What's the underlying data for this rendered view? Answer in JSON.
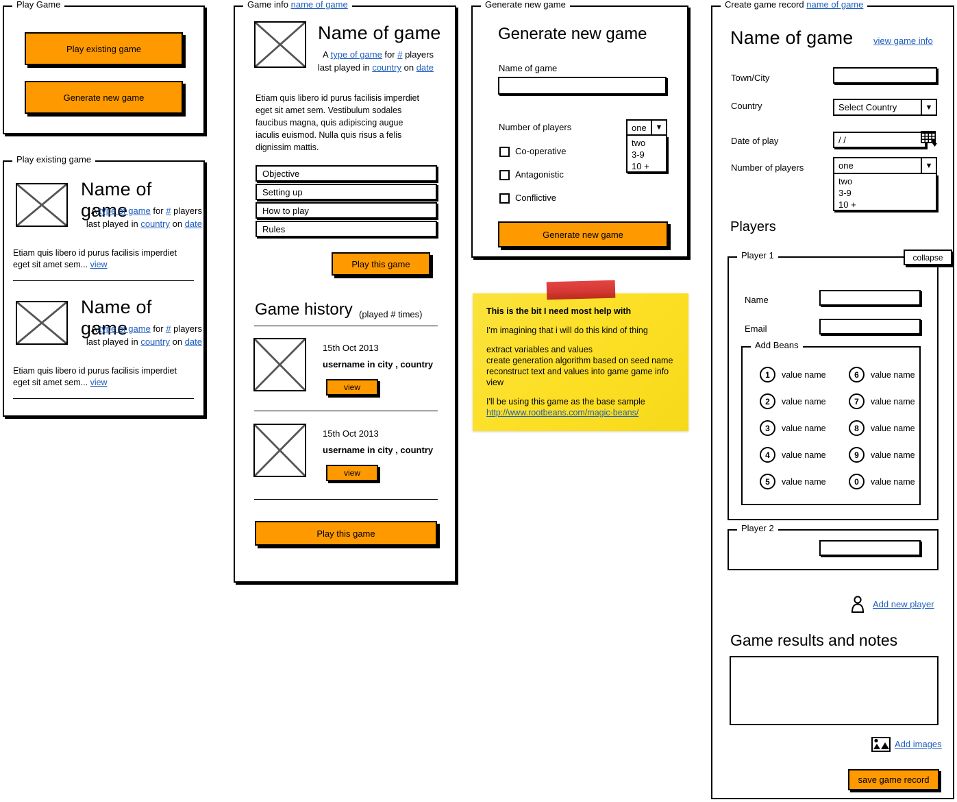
{
  "panels": {
    "play_game": {
      "legend": "Play Game"
    },
    "play_existing": {
      "legend": "Play existing game"
    },
    "game_info": {
      "legend_prefix": "Game info",
      "legend_link": "name of game"
    },
    "generate": {
      "legend": "Generate new game"
    },
    "create_record": {
      "legend_prefix": "Create game record",
      "legend_link": "name of game"
    }
  },
  "play_game": {
    "buttons": [
      {
        "label": "Play existing game"
      },
      {
        "label": "Generate new game"
      }
    ]
  },
  "play_existing": {
    "games": [
      {
        "title": "Name of game",
        "meta_a": "A",
        "type_link": "type of game",
        "meta_for": "for",
        "players_link": "#",
        "meta_players": "players",
        "meta_last": "last played in",
        "country_link": "country",
        "meta_on": "on",
        "date_link": "date",
        "excerpt": "Etiam quis libero id purus facilisis imperdiet eget sit amet sem...",
        "view_link": "view"
      },
      {
        "title": "Name of game",
        "meta_a": "A",
        "type_link": "type of game",
        "meta_for": "for",
        "players_link": "#",
        "meta_players": "players",
        "meta_last": "last played in",
        "country_link": "country",
        "meta_on": "on",
        "date_link": "date",
        "excerpt": "Etiam quis libero id purus facilisis imperdiet eget sit amet sem...",
        "view_link": "view"
      }
    ]
  },
  "game_info": {
    "title": "Name of game",
    "meta_a": "A",
    "type_link": "type of game",
    "meta_for": "for",
    "players_link": "#",
    "meta_players": "players",
    "meta_last": "last played in",
    "country_link": "country",
    "meta_on": "on",
    "date_link": "date",
    "description": "Etiam quis libero id purus facilisis imperdiet eget sit amet sem. Vestibulum sodales faucibus magna, quis adipiscing augue iaculis euismod. Nulla quis risus a felis dignissim mattis.",
    "sections": [
      "Objective",
      "Setting up",
      "How to play",
      "Rules"
    ],
    "play_button": "Play this game",
    "history_title": "Game history",
    "history_count": "(played # times)",
    "history": [
      {
        "date": "15th Oct 2013",
        "who": "username in city , country",
        "view": "view"
      },
      {
        "date": "15th Oct 2013",
        "who": "username in city , country",
        "view": "view"
      }
    ],
    "play_button_bottom": "Play this game"
  },
  "generate": {
    "heading": "Generate new game",
    "name_label": "Name of game",
    "name_value": "",
    "players_label": "Number of players",
    "players_selected": "one",
    "players_options": [
      "two",
      "3-9",
      "10 +"
    ],
    "checkboxes": [
      {
        "label": "Co-operative",
        "checked": false
      },
      {
        "label": "Antagonistic",
        "checked": false
      },
      {
        "label": "Conflictive",
        "checked": false
      }
    ],
    "submit": "Generate new game"
  },
  "note": {
    "title": "This is the bit I need most help with",
    "line1": "I'm imagining that i will do this kind of thing",
    "lines": [
      "extract variables and values",
      "create generation algorithm based on seed name",
      "reconstruct text and values into game game info",
      "view"
    ],
    "closing": "I'll be using this game as the base sample",
    "url": "http://www.rootbeans.com/magic-beans/"
  },
  "create_record": {
    "title": "Name of game",
    "view_info_link": "view game info",
    "fields": {
      "town_label": "Town/City",
      "town_value": "",
      "country_label": "Country",
      "country_selected": "Select Country",
      "date_label": "Date of play",
      "date_value": "/ /",
      "players_label": "Number of players",
      "players_selected": "one",
      "players_options": [
        "two",
        "3-9",
        "10 +"
      ]
    },
    "players_heading": "Players",
    "player1": {
      "legend": "Player 1",
      "collapse": "collapse",
      "name_label": "Name",
      "name_value": "",
      "email_label": "Email",
      "email_value": "",
      "beans_legend": "Add Beans",
      "beans_left": [
        {
          "num": "1",
          "label": "value name"
        },
        {
          "num": "2",
          "label": "value name"
        },
        {
          "num": "3",
          "label": "value name"
        },
        {
          "num": "4",
          "label": "value name"
        },
        {
          "num": "5",
          "label": "value name"
        }
      ],
      "beans_right": [
        {
          "num": "6",
          "label": "value name"
        },
        {
          "num": "7",
          "label": "value name"
        },
        {
          "num": "8",
          "label": "value name"
        },
        {
          "num": "9",
          "label": "value name"
        },
        {
          "num": "0",
          "label": "value name"
        }
      ]
    },
    "player2": {
      "legend": "Player 2",
      "value": ""
    },
    "add_player_link": "Add new player",
    "results_heading": "Game results and notes",
    "results_value": "",
    "add_images_link": "Add images",
    "save_button": "save game record"
  },
  "colors": {
    "accent": "#FF9900",
    "link": "#1f5fbf",
    "sticky": "#FCE53E",
    "tape": "#D5302C",
    "ink": "#000000"
  }
}
